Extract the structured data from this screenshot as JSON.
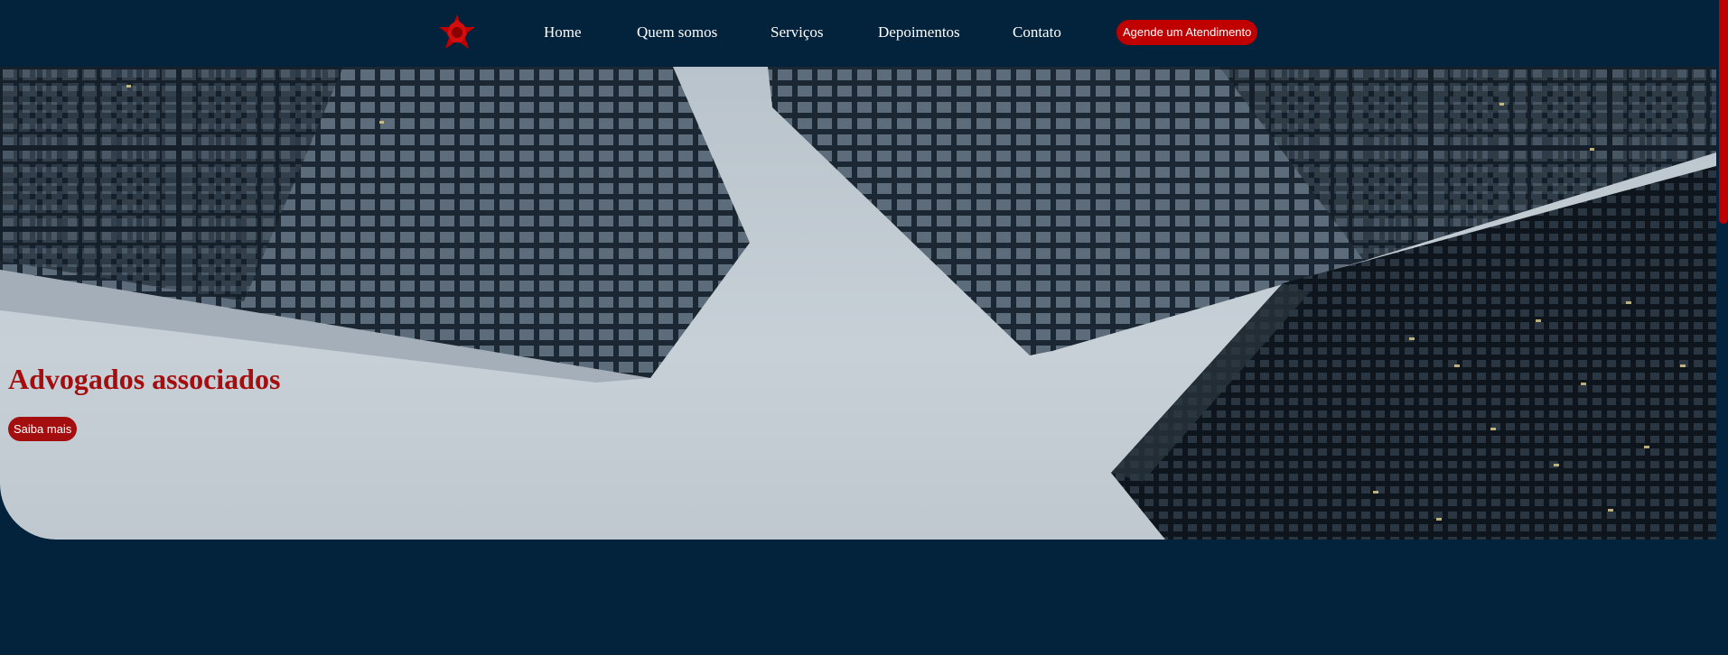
{
  "header": {
    "logo_icon": "red-star-logo",
    "nav": [
      {
        "label": "Home"
      },
      {
        "label": "Quem somos"
      },
      {
        "label": "Serviços"
      },
      {
        "label": "Depoimentos"
      },
      {
        "label": "Contato"
      }
    ],
    "cta_label": "Agende um Atendimento"
  },
  "hero": {
    "title": "Advogados associados",
    "button_label": "Saiba mais",
    "background": "skyscrapers-photo"
  },
  "colors": {
    "background": "#02233b",
    "accent": "#c00000",
    "hero_title": "#a50e0e"
  }
}
